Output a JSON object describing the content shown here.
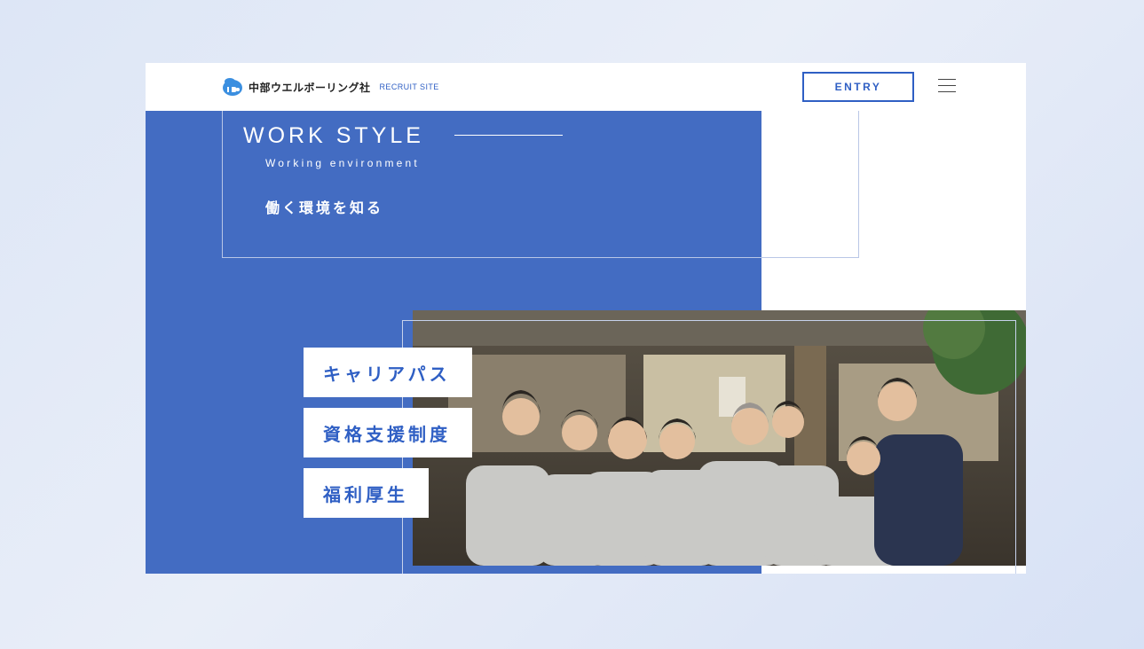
{
  "header": {
    "logo_name": "中部ウエルボーリング社",
    "logo_sub": "RECRUIT SITE",
    "entry_label": "ENTRY",
    "logo_icon": "company-logo-icon",
    "menu_icon": "hamburger-menu-icon"
  },
  "section": {
    "title": "WORK STYLE",
    "subtitle": "Working environment",
    "jp_title": "働く環境を知る"
  },
  "links": [
    {
      "label": "キャリアパス"
    },
    {
      "label": "資格支援制度"
    },
    {
      "label": "福利厚生"
    }
  ],
  "colors": {
    "accent": "#2f5fc4",
    "block": "#436cc2"
  }
}
